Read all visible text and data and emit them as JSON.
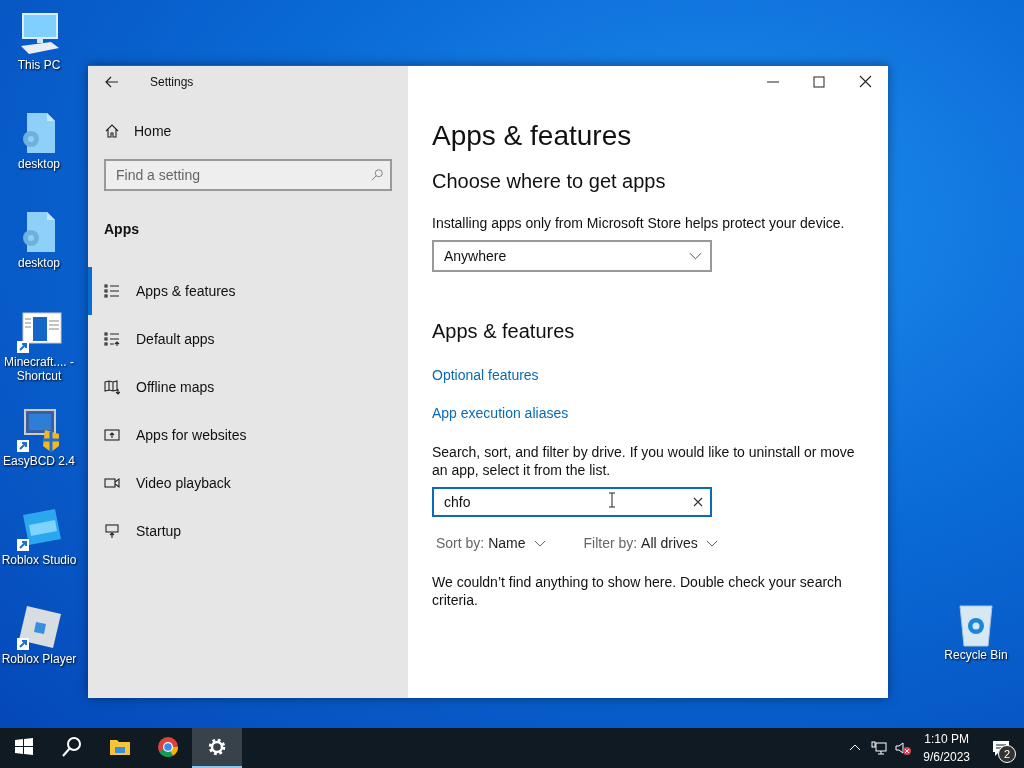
{
  "desktop_icons": [
    {
      "label": "This PC",
      "kind": "pc"
    },
    {
      "label": "desktop",
      "kind": "file"
    },
    {
      "label": "desktop",
      "kind": "file"
    },
    {
      "label": "Minecraft.... - Shortcut",
      "kind": "window"
    },
    {
      "label": "EasyBCD 2.4",
      "kind": "monitor"
    },
    {
      "label": "Roblox Studio",
      "kind": "studio"
    },
    {
      "label": "Roblox Player",
      "kind": "player"
    }
  ],
  "recycle_bin": {
    "label": "Recycle Bin"
  },
  "window": {
    "title": "Settings",
    "sidebar": {
      "home": "Home",
      "search": {
        "placeholder": "Find a setting"
      },
      "section": "Apps",
      "items": [
        {
          "label": "Apps & features",
          "kind": "list",
          "selected": true
        },
        {
          "label": "Default apps",
          "kind": "default",
          "selected": false
        },
        {
          "label": "Offline maps",
          "kind": "map",
          "selected": false
        },
        {
          "label": "Apps for websites",
          "kind": "web",
          "selected": false
        },
        {
          "label": "Video playback",
          "kind": "video",
          "selected": false
        },
        {
          "label": "Startup",
          "kind": "startup",
          "selected": false
        }
      ]
    },
    "content": {
      "title": "Apps & features",
      "subtitle": "Choose where to get apps",
      "store_note": "Installing apps only from Microsoft Store helps protect your device.",
      "source_dropdown": {
        "value": "Anywhere"
      },
      "section": "Apps & features",
      "links": [
        "Optional features",
        "App execution aliases"
      ],
      "search_note": "Search, sort, and filter by drive. If you would like to uninstall or move an app, select it from the list.",
      "search": {
        "value": "chfo"
      },
      "sort": {
        "label": "Sort by:",
        "value": "Name"
      },
      "filter": {
        "label": "Filter by:",
        "value": "All drives"
      },
      "message": "We couldn’t find anything to show here. Double check your search criteria."
    }
  },
  "taskbar": {
    "items": [
      {
        "kind": "start",
        "selected": false
      },
      {
        "kind": "search",
        "selected": false
      },
      {
        "kind": "explorer",
        "selected": false
      },
      {
        "kind": "chrome",
        "selected": false
      },
      {
        "kind": "settings",
        "selected": true
      }
    ],
    "time": "1:10 PM",
    "date": "9/6/2023",
    "notifications": "2"
  }
}
